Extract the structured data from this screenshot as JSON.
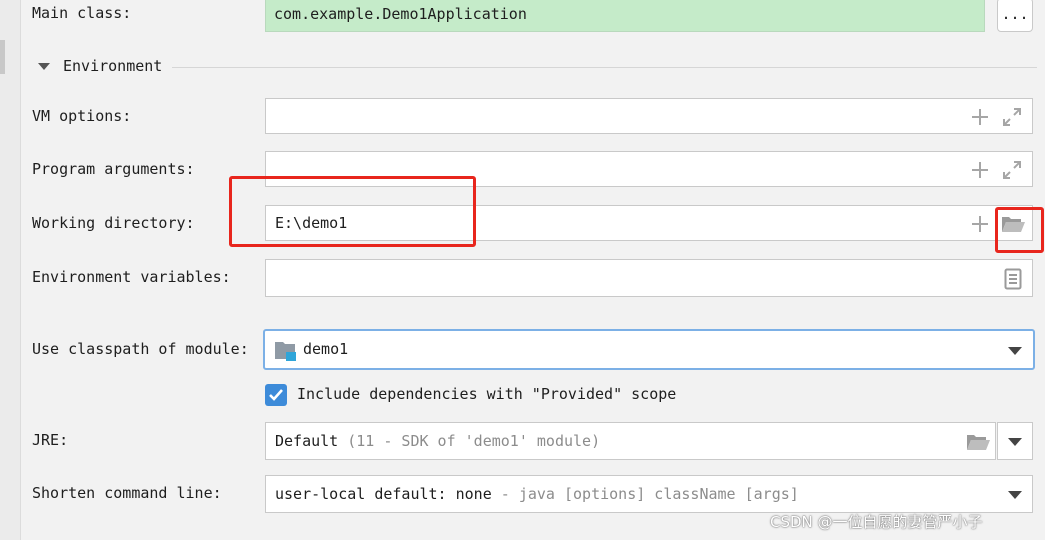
{
  "main_class": {
    "label": "Main class:",
    "value": "com.example.Demo1Application",
    "browse_label": "..."
  },
  "environment": {
    "title": "Environment"
  },
  "vm_options": {
    "label": "VM options:",
    "value": ""
  },
  "program_arguments": {
    "label": "Program arguments:",
    "value": ""
  },
  "working_directory": {
    "label": "Working directory:",
    "value": "E:\\demo1"
  },
  "environment_variables": {
    "label": "Environment variables:",
    "value": ""
  },
  "classpath_module": {
    "label": "Use classpath of module:",
    "value": "demo1"
  },
  "include_dependencies": {
    "label": "Include dependencies with \"Provided\" scope",
    "checked": true
  },
  "jre": {
    "label": "JRE:",
    "value": "Default",
    "hint": "(11 - SDK of 'demo1' module)"
  },
  "shorten_command_line": {
    "label": "Shorten command line:",
    "value": "user-local default: none",
    "hint": "- java [options] className [args]"
  },
  "watermark": "CSDN @一位自愿的妻管严小子",
  "colors": {
    "main_class_bg": "#c5ebc9",
    "focus_border": "#7cb0e6",
    "highlight_red": "#e8261d",
    "checkbox_blue": "#3d8bd9"
  },
  "icons": [
    "plus-icon",
    "expand-icon",
    "folder-icon",
    "document-icon",
    "module-icon",
    "chevron-down-icon",
    "check-icon",
    "triangle-down-icon"
  ]
}
